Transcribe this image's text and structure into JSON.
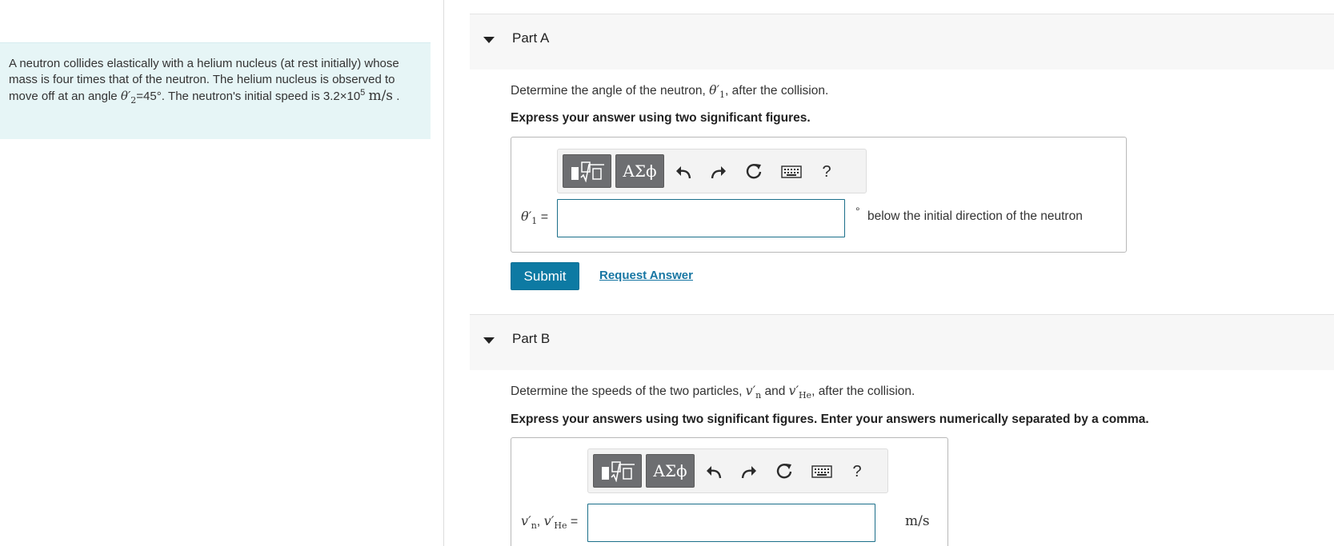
{
  "problem": {
    "text_a": "A neutron collides elastically with a helium nucleus (at rest initially) whose mass is four times that of the neutron. The helium nucleus is observed to move off at an angle ",
    "theta2_symbol": "θ",
    "theta2_prime": "′",
    "theta2_sub": "2",
    "angle_value": "=45°",
    "text_b": ". The neutron's initial speed is 3.2×10",
    "exp": "5",
    "unit": "m/s",
    "end": " ."
  },
  "part_a": {
    "title": "Part A",
    "prompt_a": "Determine the angle of the neutron, ",
    "sym": "θ",
    "prime": "′",
    "sub": "1",
    "prompt_b": ", after the collision.",
    "instruction": "Express your answer using two significant figures.",
    "label_sym": "θ",
    "label_prime": "′",
    "label_sub": "1",
    "label_eq": " =",
    "input_value": "",
    "degree": "°",
    "unit_text": "below the initial direction of the neutron",
    "submit_label": "Submit",
    "request_label": "Request Answer"
  },
  "part_b": {
    "title": "Part B",
    "prompt_a": "Determine the speeds of the two particles, ",
    "v": "v",
    "prime": "′",
    "n": "n",
    "and": " and ",
    "he": "He",
    "prompt_b": ", after the collision.",
    "instruction": "Express your answers using two significant figures. Enter your answers numerically separated by a comma.",
    "label_comma": ", ",
    "label_eq": " =",
    "input_value": "",
    "unit": "m/s"
  },
  "toolbar": {
    "symbols_label": "ΑΣϕ",
    "help_label": "?",
    "icons": [
      "templates-icon",
      "symbols-icon",
      "undo-icon",
      "redo-icon",
      "reset-icon",
      "keyboard-icon",
      "help-icon"
    ]
  }
}
